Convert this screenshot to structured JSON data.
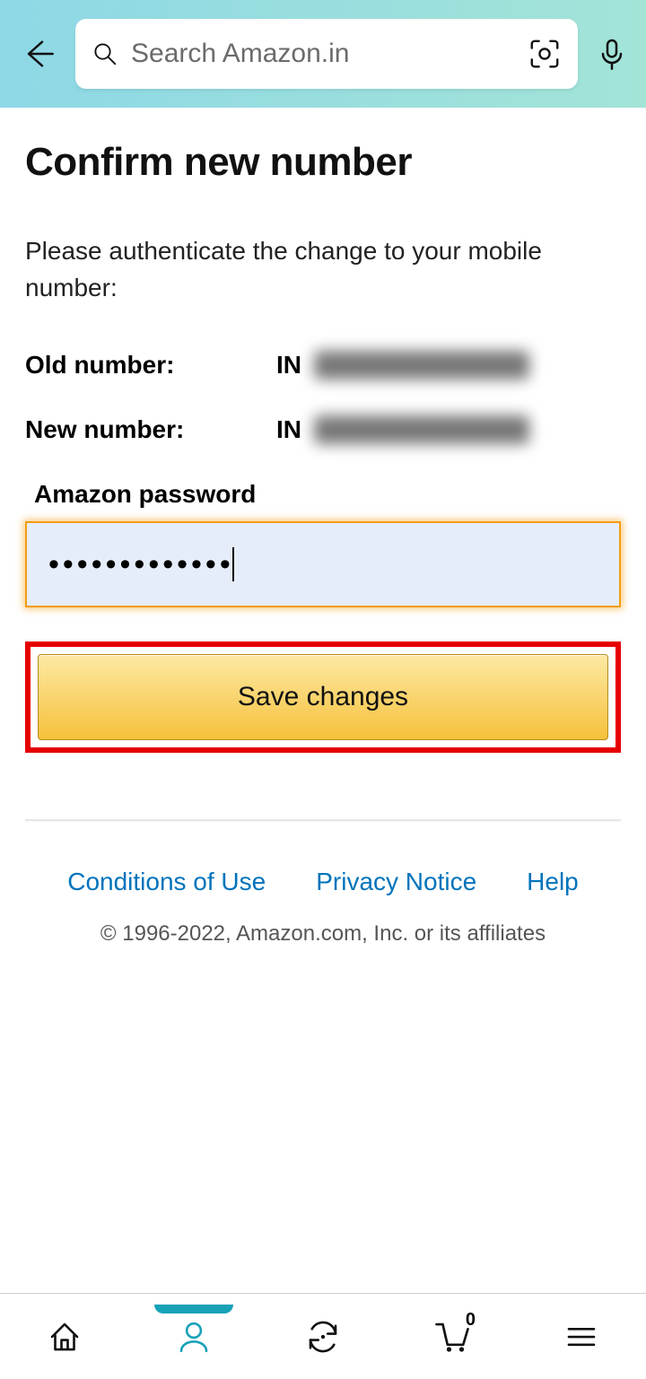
{
  "header": {
    "search_placeholder": "Search Amazon.in"
  },
  "page": {
    "title": "Confirm new number",
    "instruction": "Please authenticate the change to your mobile number:",
    "old_label": "Old number:",
    "new_label": "New number:",
    "country_code": "IN",
    "password_label": "Amazon password",
    "password_masked": "•••••••••••••",
    "save_label": "Save changes"
  },
  "footer": {
    "links": {
      "conditions": "Conditions of Use",
      "privacy": "Privacy Notice",
      "help": "Help"
    },
    "copyright": "© 1996-2022, Amazon.com, Inc. or its affiliates"
  },
  "nav": {
    "cart_count": "0"
  }
}
